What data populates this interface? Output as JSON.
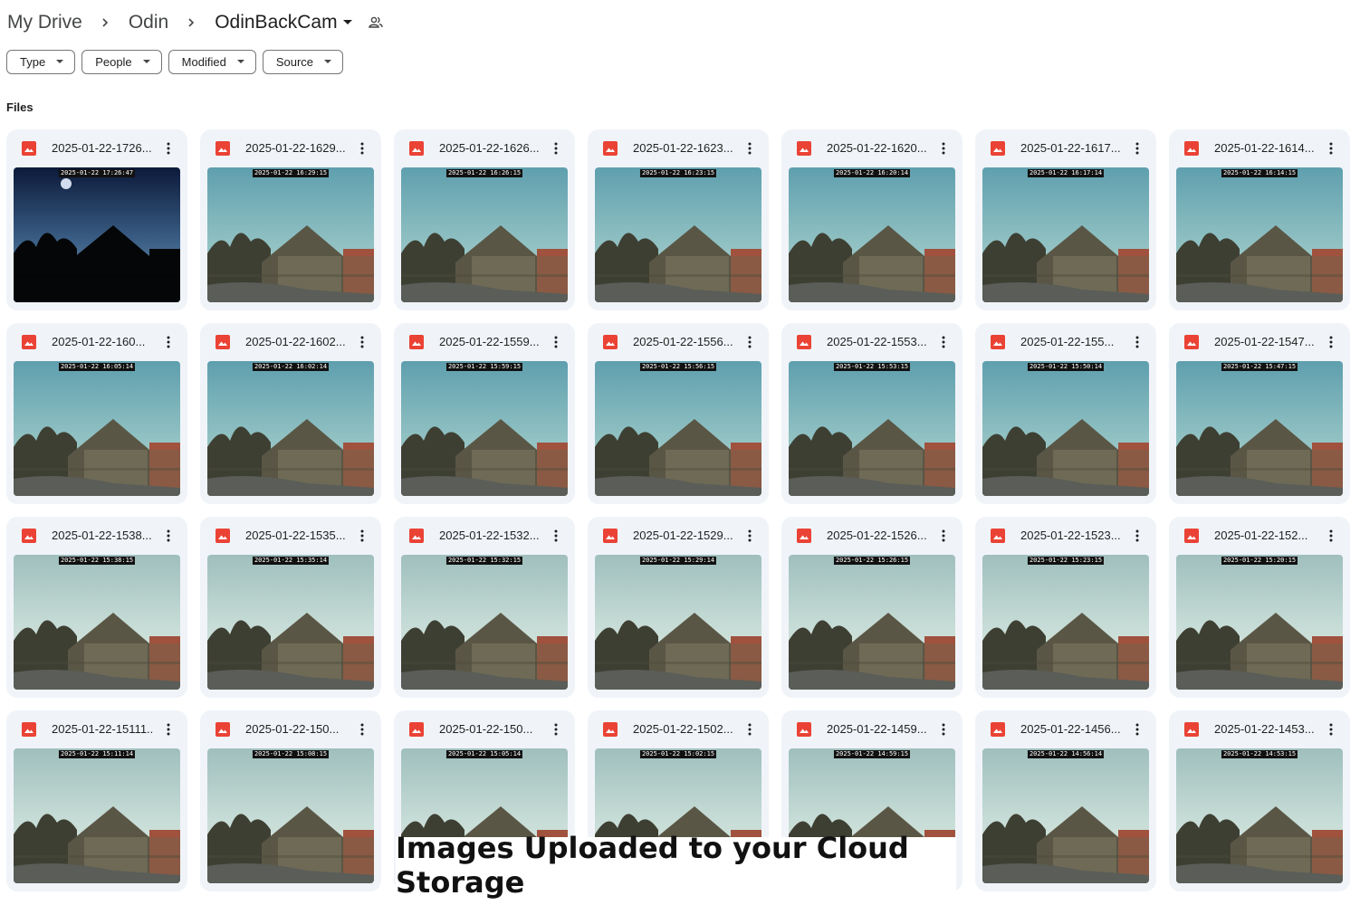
{
  "breadcrumb": {
    "items": [
      "My Drive",
      "Odin",
      "OdinBackCam"
    ],
    "separator_icon": "chevron-right-icon",
    "dropdown_icon": "caret-down-icon",
    "shared_icon": "people-icon"
  },
  "filters": [
    "Type",
    "People",
    "Modified",
    "Source"
  ],
  "section_label": "Files",
  "colors": {
    "file_icon": "#ea4335",
    "card_bg": "#f0f4f9",
    "text": "#1f1f1f"
  },
  "files": [
    {
      "name": "2025-01-22-1726...",
      "stamp": "2025-01-22 17:26:47",
      "scene": "dusk"
    },
    {
      "name": "2025-01-22-1629...",
      "stamp": "2025-01-22 16:29:15",
      "scene": "blue"
    },
    {
      "name": "2025-01-22-1626...",
      "stamp": "2025-01-22 16:26:15",
      "scene": "blue"
    },
    {
      "name": "2025-01-22-1623...",
      "stamp": "2025-01-22 16:23:15",
      "scene": "blue"
    },
    {
      "name": "2025-01-22-1620...",
      "stamp": "2025-01-22 16:20:14",
      "scene": "blue"
    },
    {
      "name": "2025-01-22-1617...",
      "stamp": "2025-01-22 16:17:14",
      "scene": "blue"
    },
    {
      "name": "2025-01-22-1614...",
      "stamp": "2025-01-22 16:14:15",
      "scene": "blue"
    },
    {
      "name": "2025-01-22-160...",
      "stamp": "2025-01-22 16:05:14",
      "scene": "blue"
    },
    {
      "name": "2025-01-22-1602...",
      "stamp": "2025-01-22 16:02:14",
      "scene": "blue"
    },
    {
      "name": "2025-01-22-1559...",
      "stamp": "2025-01-22 15:59:15",
      "scene": "blue"
    },
    {
      "name": "2025-01-22-1556...",
      "stamp": "2025-01-22 15:56:15",
      "scene": "blue"
    },
    {
      "name": "2025-01-22-1553...",
      "stamp": "2025-01-22 15:53:15",
      "scene": "blue"
    },
    {
      "name": "2025-01-22-155...",
      "stamp": "2025-01-22 15:50:14",
      "scene": "blue"
    },
    {
      "name": "2025-01-22-1547...",
      "stamp": "2025-01-22 15:47:15",
      "scene": "blue"
    },
    {
      "name": "2025-01-22-1538...",
      "stamp": "2025-01-22 15:38:15",
      "scene": "cloudy"
    },
    {
      "name": "2025-01-22-1535...",
      "stamp": "2025-01-22 15:35:14",
      "scene": "cloudy"
    },
    {
      "name": "2025-01-22-1532...",
      "stamp": "2025-01-22 15:32:15",
      "scene": "cloudy"
    },
    {
      "name": "2025-01-22-1529...",
      "stamp": "2025-01-22 15:29:14",
      "scene": "cloudy"
    },
    {
      "name": "2025-01-22-1526...",
      "stamp": "2025-01-22 15:26:15",
      "scene": "cloudy"
    },
    {
      "name": "2025-01-22-1523...",
      "stamp": "2025-01-22 15:23:15",
      "scene": "cloudy"
    },
    {
      "name": "2025-01-22-152...",
      "stamp": "2025-01-22 15:20:15",
      "scene": "cloudy"
    },
    {
      "name": "2025-01-22-15111...",
      "stamp": "2025-01-22 15:11:14",
      "scene": "cloudy"
    },
    {
      "name": "2025-01-22-150...",
      "stamp": "2025-01-22 15:08:15",
      "scene": "cloudy"
    },
    {
      "name": "2025-01-22-150...",
      "stamp": "2025-01-22 15:05:14",
      "scene": "cloudy"
    },
    {
      "name": "2025-01-22-1502...",
      "stamp": "2025-01-22 15:02:15",
      "scene": "cloudy"
    },
    {
      "name": "2025-01-22-1459...",
      "stamp": "2025-01-22 14:59:15",
      "scene": "cloudy"
    },
    {
      "name": "2025-01-22-1456...",
      "stamp": "2025-01-22 14:56:14",
      "scene": "cloudy"
    },
    {
      "name": "2025-01-22-1453...",
      "stamp": "2025-01-22 14:53:15",
      "scene": "cloudy"
    }
  ],
  "caption": "Images Uploaded to your Cloud Storage"
}
